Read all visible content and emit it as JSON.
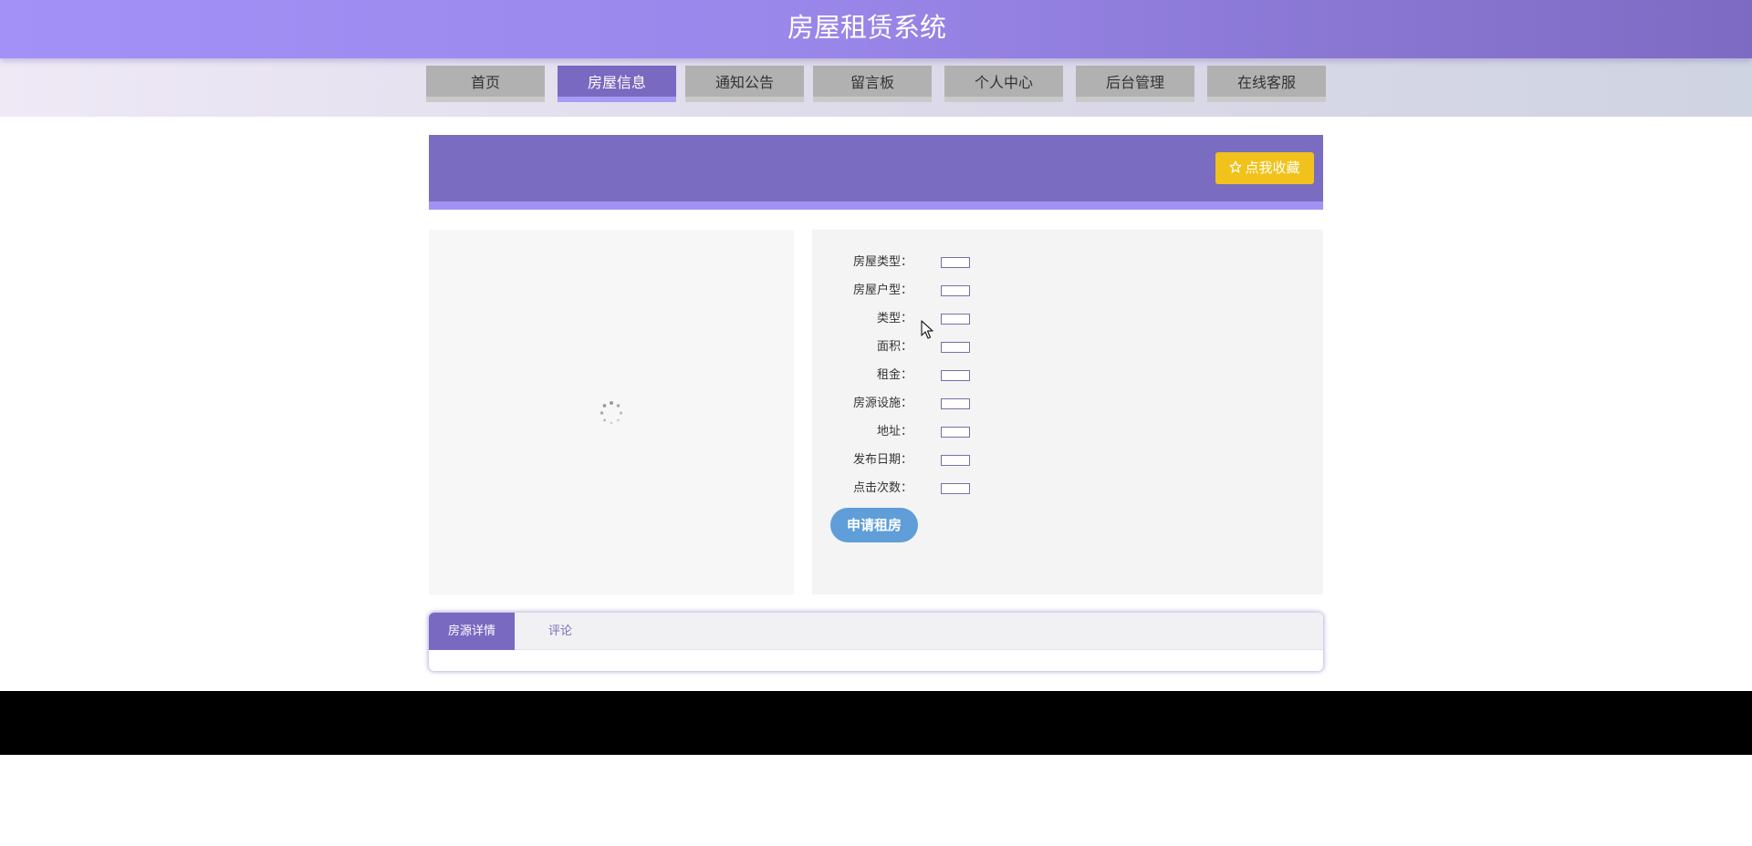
{
  "header": {
    "site_title": "房屋租赁系统"
  },
  "nav": {
    "items": [
      {
        "label": "首页",
        "active": false
      },
      {
        "label": "房屋信息",
        "active": true
      },
      {
        "label": "通知公告",
        "active": false
      },
      {
        "label": "留言板",
        "active": false
      },
      {
        "label": "个人中心",
        "active": false
      },
      {
        "label": "后台管理",
        "active": false
      },
      {
        "label": "在线客服",
        "active": false
      }
    ]
  },
  "banner": {
    "favorite_label": "点我收藏",
    "favorite_icon": "star-outline-icon"
  },
  "details": {
    "fields": [
      {
        "label": "房屋类型：",
        "value": ""
      },
      {
        "label": "房屋户型：",
        "value": ""
      },
      {
        "label": "类型：",
        "value": ""
      },
      {
        "label": "面积：",
        "value": ""
      },
      {
        "label": "租金：",
        "value": ""
      },
      {
        "label": "房源设施：",
        "value": ""
      },
      {
        "label": "地址：",
        "value": ""
      },
      {
        "label": "发布日期：",
        "value": ""
      },
      {
        "label": "点击次数：",
        "value": ""
      }
    ],
    "apply_label": "申请租房"
  },
  "tabs": {
    "items": [
      {
        "label": "房源详情",
        "active": true
      },
      {
        "label": "评论",
        "active": false
      }
    ]
  },
  "colors": {
    "primary": "#7a69c0",
    "accent_light": "#a392f4",
    "favorite_button": "#f1c21b",
    "apply_button": "#5f9ed8",
    "footer": "#000000"
  }
}
